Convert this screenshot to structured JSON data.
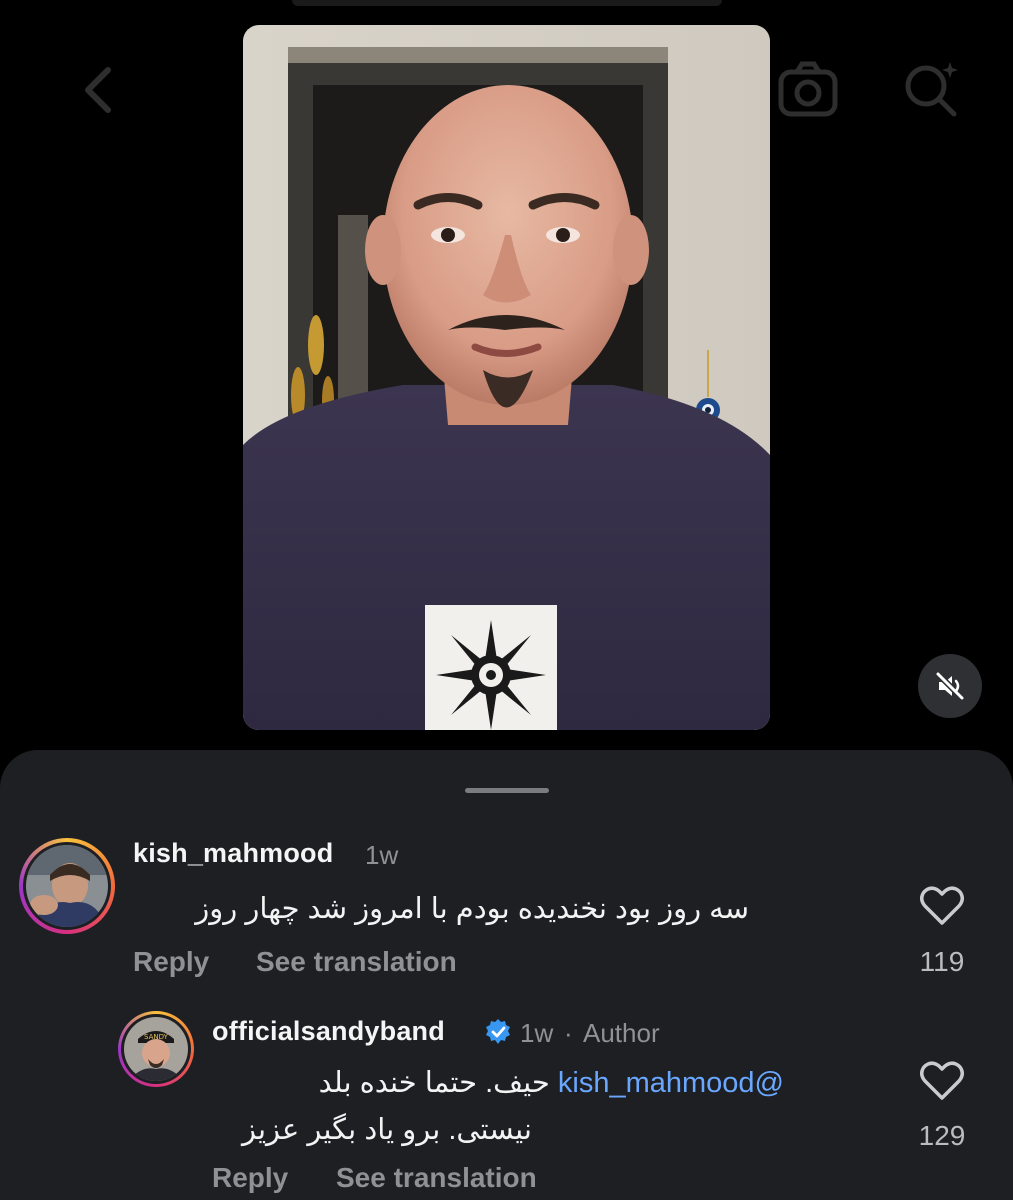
{
  "video": {
    "muted": true
  },
  "comments": [
    {
      "username": "kish_mahmood",
      "time": "1w",
      "text": "سه روز بود نخندیده بودم با امروز شد چهار روز",
      "reply_label": "Reply",
      "translate_label": "See translation",
      "likes": "119"
    }
  ],
  "reply": {
    "username": "officialsandyband",
    "time": "1w",
    "separator": "·",
    "author_badge": "Author",
    "mention": "@kish_mahmood",
    "line1": "حیف. حتما خنده بلد",
    "line2": "نیستی. برو یاد بگیر عزیز",
    "reply_label": "Reply",
    "translate_label": "See translation",
    "likes": "129",
    "avatar_cap_text": "SANDY"
  },
  "colors": {
    "sheet": "#1d1f23",
    "muted_text": "#8e9196",
    "mention": "#6aa7ff",
    "verified": "#3897f0"
  }
}
